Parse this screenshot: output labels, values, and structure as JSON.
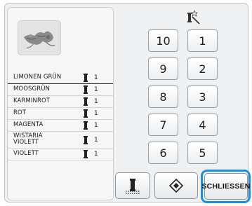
{
  "colors": [
    {
      "name": "LIMONEN GRÜN",
      "qty": "1"
    },
    {
      "name": "MOOSGRÜN",
      "qty": "1"
    },
    {
      "name": "KARMINROT",
      "qty": "1"
    },
    {
      "name": "ROT",
      "qty": "1"
    },
    {
      "name": "MAGENTA",
      "qty": "1"
    },
    {
      "name": "WISTARIA VIOLETT",
      "qty": "1"
    },
    {
      "name": "VIOLETT",
      "qty": "1"
    }
  ],
  "keypad": {
    "keys": [
      "10",
      "1",
      "9",
      "2",
      "8",
      "3",
      "7",
      "4",
      "6",
      "5"
    ]
  },
  "buttons": {
    "close_label": "SCHLIESSEN"
  },
  "icons": {
    "spool": "spool-icon",
    "wand": "magic-wand-icon",
    "thread": "thread-icon",
    "eraser": "eraser-icon"
  }
}
